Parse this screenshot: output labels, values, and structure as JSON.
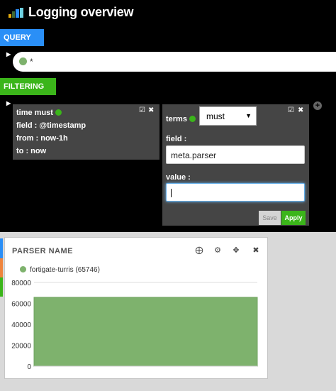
{
  "header": {
    "title": "Logging overview",
    "logo_colors": [
      "#e5ac0e",
      "#3f6833",
      "#2a8ff7",
      "#6ed0e0"
    ]
  },
  "query": {
    "tab_label": "QUERY",
    "value": "*",
    "dot_color": "#7eb26d"
  },
  "filtering": {
    "tab_label": "FILTERING",
    "filter1": {
      "title": "time must",
      "field_line": "field : @timestamp",
      "from_line": "from : now-1h",
      "to_line": "to : now"
    },
    "filter2": {
      "type_label": "terms",
      "mode_selected": "must",
      "field_label": "field :",
      "field_value": "meta.parser",
      "value_label": "value :",
      "value_value": "",
      "save_label": "Save",
      "apply_label": "Apply"
    }
  },
  "side_strip_colors": [
    "#2a8ff7",
    "#ef843c",
    "#3bb51a"
  ],
  "panel": {
    "title": "PARSER NAME",
    "legend": "fortigate-turris (65746)"
  },
  "chart_data": {
    "type": "area",
    "series": [
      {
        "name": "fortigate-turris (65746)",
        "color": "#7eb26d",
        "values": [
          65746,
          65746
        ]
      }
    ],
    "yticks": [
      0,
      20000,
      40000,
      60000,
      80000
    ],
    "ylim": [
      0,
      80000
    ],
    "grid": true,
    "legend_position": "top-left"
  }
}
